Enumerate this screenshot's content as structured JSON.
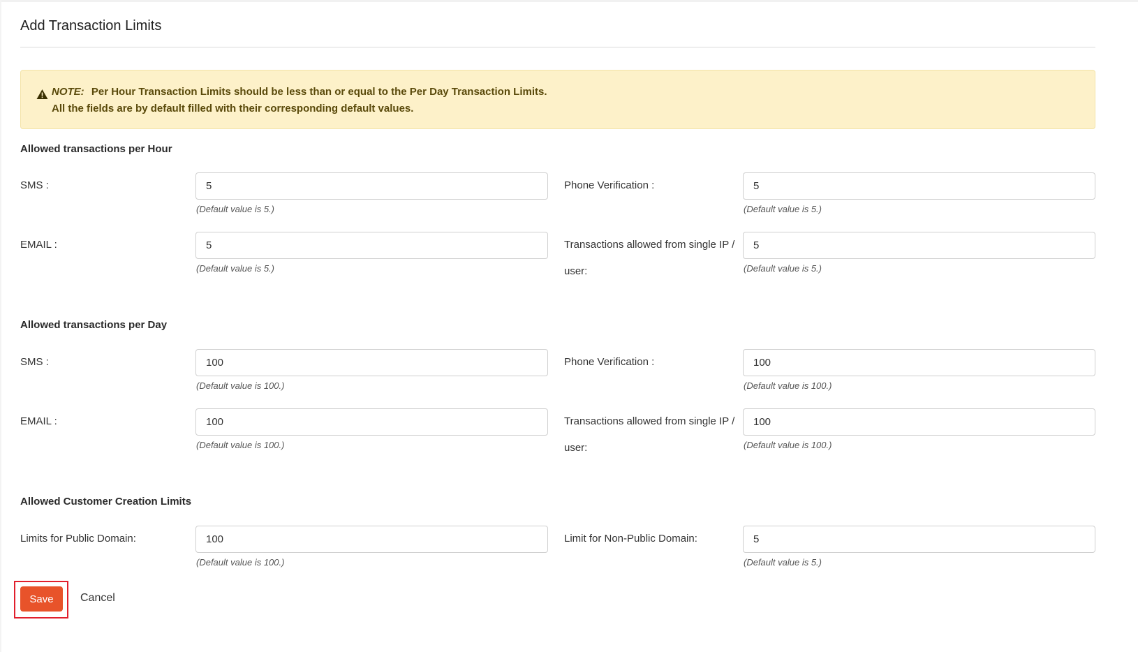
{
  "page": {
    "title": "Add Transaction Limits"
  },
  "note": {
    "label": "NOTE:",
    "line1": "Per Hour Transaction Limits should be less than or equal to the Per Day Transaction Limits.",
    "line2": "All the fields are by default filled with their corresponding default values."
  },
  "hour": {
    "heading": "Allowed transactions per Hour",
    "sms": {
      "label": "SMS :",
      "value": "5",
      "hint": "(Default value is 5.)"
    },
    "phone": {
      "label": "Phone Verification :",
      "value": "5",
      "hint": "(Default value is 5.)"
    },
    "email": {
      "label": "EMAIL :",
      "value": "5",
      "hint": "(Default value is 5.)"
    },
    "ip": {
      "label": "Transactions allowed from single IP / user:",
      "value": "5",
      "hint": "(Default value is 5.)"
    }
  },
  "day": {
    "heading": "Allowed transactions per Day",
    "sms": {
      "label": "SMS :",
      "value": "100",
      "hint": "(Default value is 100.)"
    },
    "phone": {
      "label": "Phone Verification :",
      "value": "100",
      "hint": "(Default value is 100.)"
    },
    "email": {
      "label": "EMAIL :",
      "value": "100",
      "hint": "(Default value is 100.)"
    },
    "ip": {
      "label": "Transactions allowed from single IP / user:",
      "value": "100",
      "hint": "(Default value is 100.)"
    }
  },
  "customer": {
    "heading": "Allowed Customer Creation Limits",
    "public": {
      "label": "Limits for Public Domain:",
      "value": "100",
      "hint": "(Default value is 100.)"
    },
    "nonpublic": {
      "label": "Limit for Non-Public Domain:",
      "value": "5",
      "hint": "(Default value is 5.)"
    }
  },
  "actions": {
    "save": "Save",
    "cancel": "Cancel"
  },
  "colors": {
    "accent": "#e8532a",
    "highlight": "#e11f2c",
    "note_bg": "#fdf1c9",
    "note_text": "#5a4a0b"
  },
  "icons": {
    "note": "warning-icon"
  }
}
